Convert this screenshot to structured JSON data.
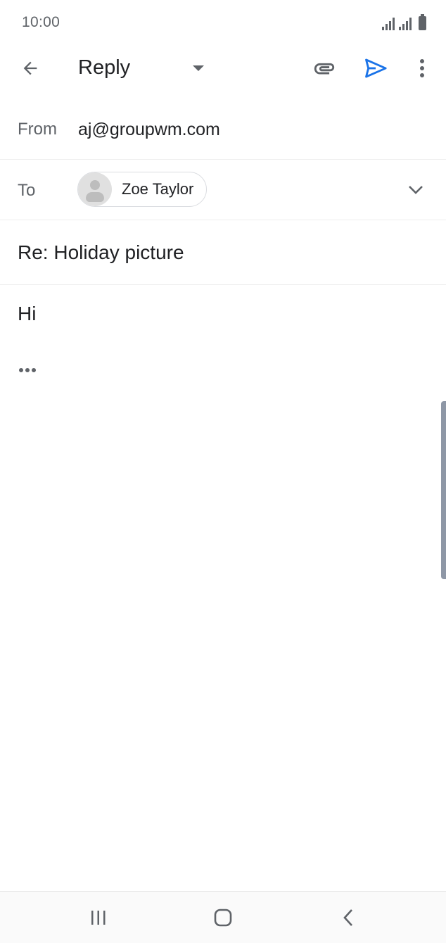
{
  "status_bar": {
    "time": "10:00",
    "icons": [
      "signal-icon",
      "signal-icon",
      "battery-icon"
    ]
  },
  "app_bar": {
    "title": "Reply",
    "icons": {
      "back": "arrow-back-icon",
      "dropdown": "dropdown-arrow-icon",
      "attach": "paperclip-icon",
      "send": "send-icon",
      "more": "more-vert-icon"
    }
  },
  "compose": {
    "from_label": "From",
    "from_value": "aj@groupwm.com",
    "to_label": "To",
    "recipient_name": "Zoe Taylor",
    "subject": "Re: Holiday picture",
    "body": "Hi"
  },
  "colors": {
    "accent": "#1a73e8",
    "icon_gray": "#5f6368",
    "text": "#202124"
  }
}
